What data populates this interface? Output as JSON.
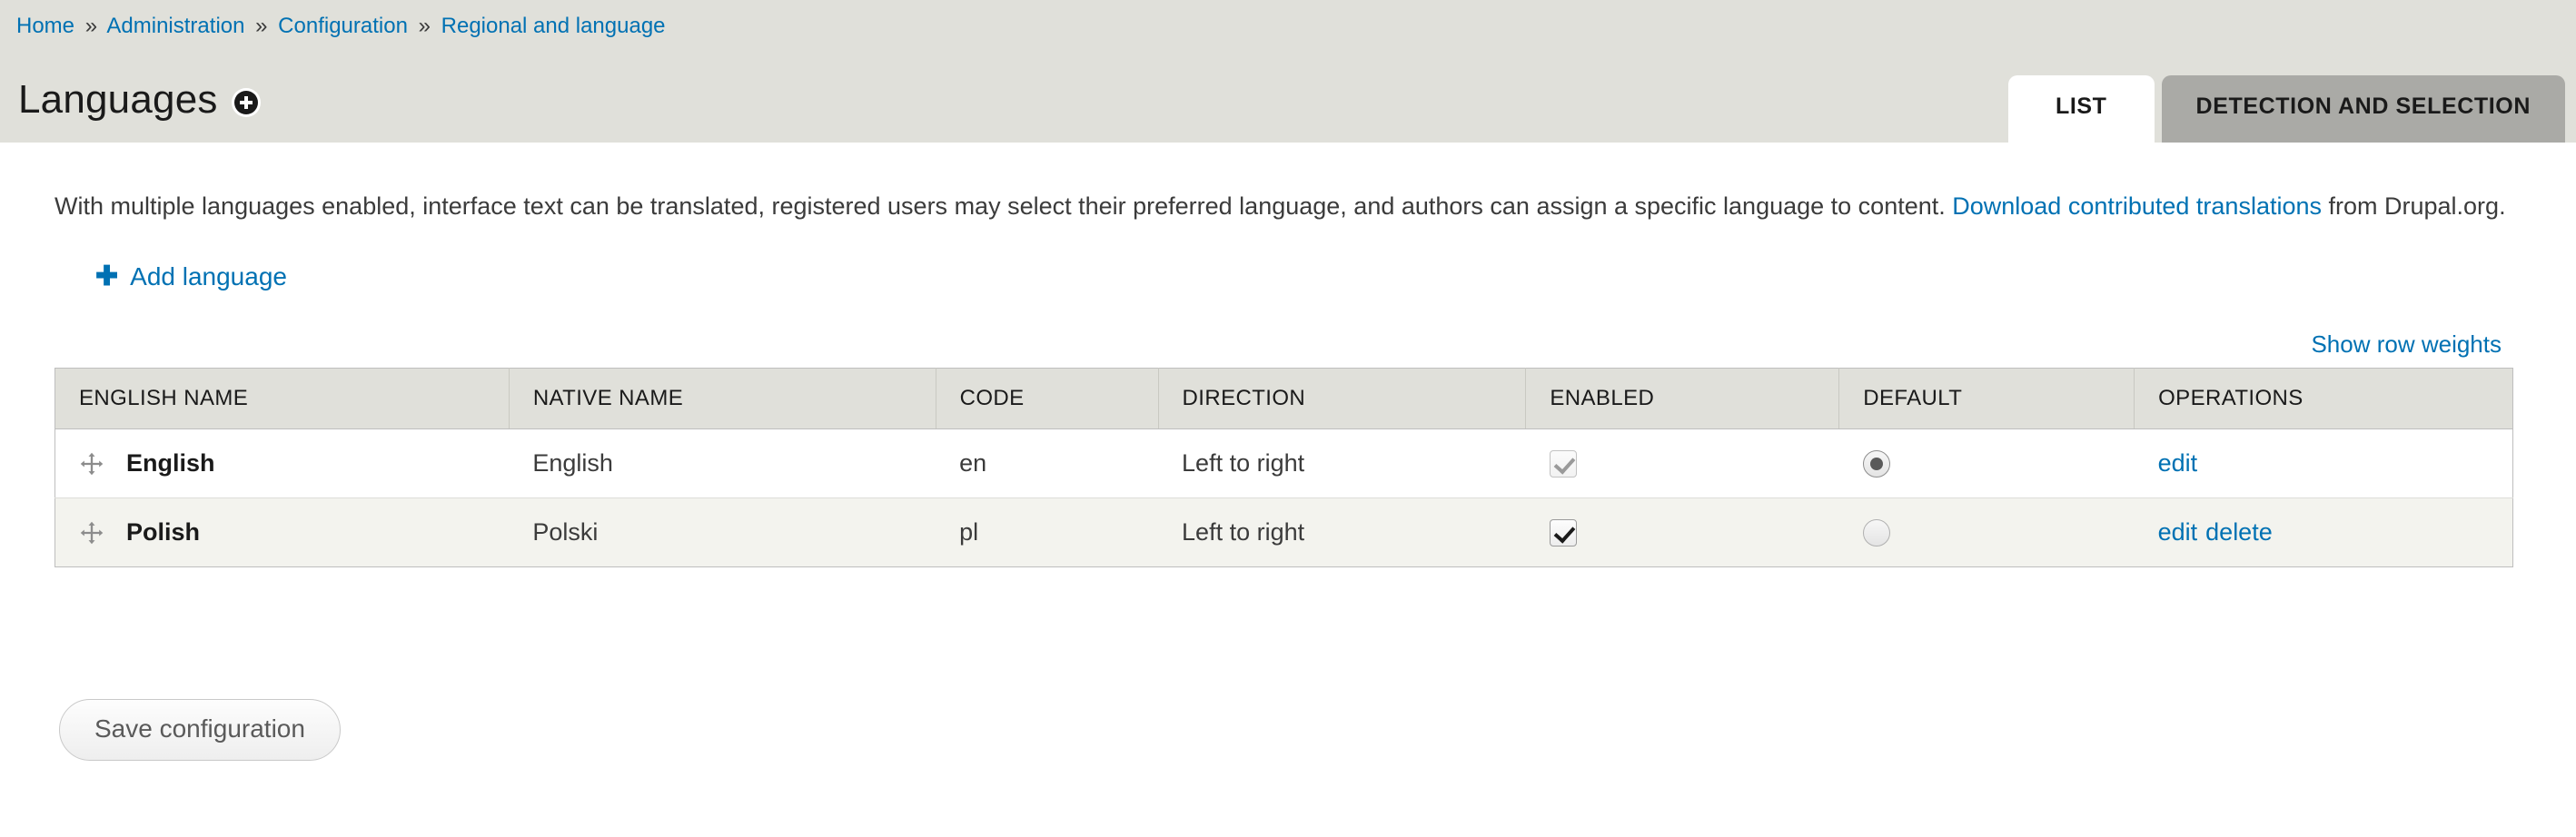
{
  "breadcrumb": {
    "separator": "»",
    "items": [
      {
        "label": "Home"
      },
      {
        "label": "Administration"
      },
      {
        "label": "Configuration"
      },
      {
        "label": "Regional and language"
      }
    ]
  },
  "header": {
    "title": "Languages",
    "contextual_icon": "plus-circle-icon"
  },
  "tabs": [
    {
      "label": "List",
      "active": true
    },
    {
      "label": "Detection and selection",
      "active": false
    }
  ],
  "intro": {
    "text_before_link": "With multiple languages enabled, interface text can be translated, registered users may select their preferred language, and authors can assign a specific language to content. ",
    "link_label": "Download contributed translations",
    "text_after_link": " from Drupal.org."
  },
  "actions": {
    "add_language_label": "Add language",
    "add_language_icon": "plus-icon",
    "show_row_weights_label": "Show row weights"
  },
  "table": {
    "columns": [
      "English name",
      "Native name",
      "Code",
      "Direction",
      "Enabled",
      "Default",
      "Operations"
    ],
    "rows": [
      {
        "drag_icon": "drag-move-icon",
        "english_name": "English",
        "native_name": "English",
        "code": "en",
        "direction": "Left to right",
        "enabled": true,
        "enabled_disabled": true,
        "default": true,
        "operations": [
          "edit"
        ]
      },
      {
        "drag_icon": "drag-move-icon",
        "english_name": "Polish",
        "native_name": "Polski",
        "code": "pl",
        "direction": "Left to right",
        "enabled": true,
        "enabled_disabled": false,
        "default": false,
        "operations": [
          "edit",
          "delete"
        ]
      }
    ]
  },
  "footer": {
    "save_label": "Save configuration"
  },
  "colors": {
    "link": "#0071b3",
    "band_bg": "#e0e0da",
    "tab_inactive_bg": "#aaaaa6",
    "row_even_bg": "#f3f3ee",
    "page_bg": "#ffffff"
  }
}
